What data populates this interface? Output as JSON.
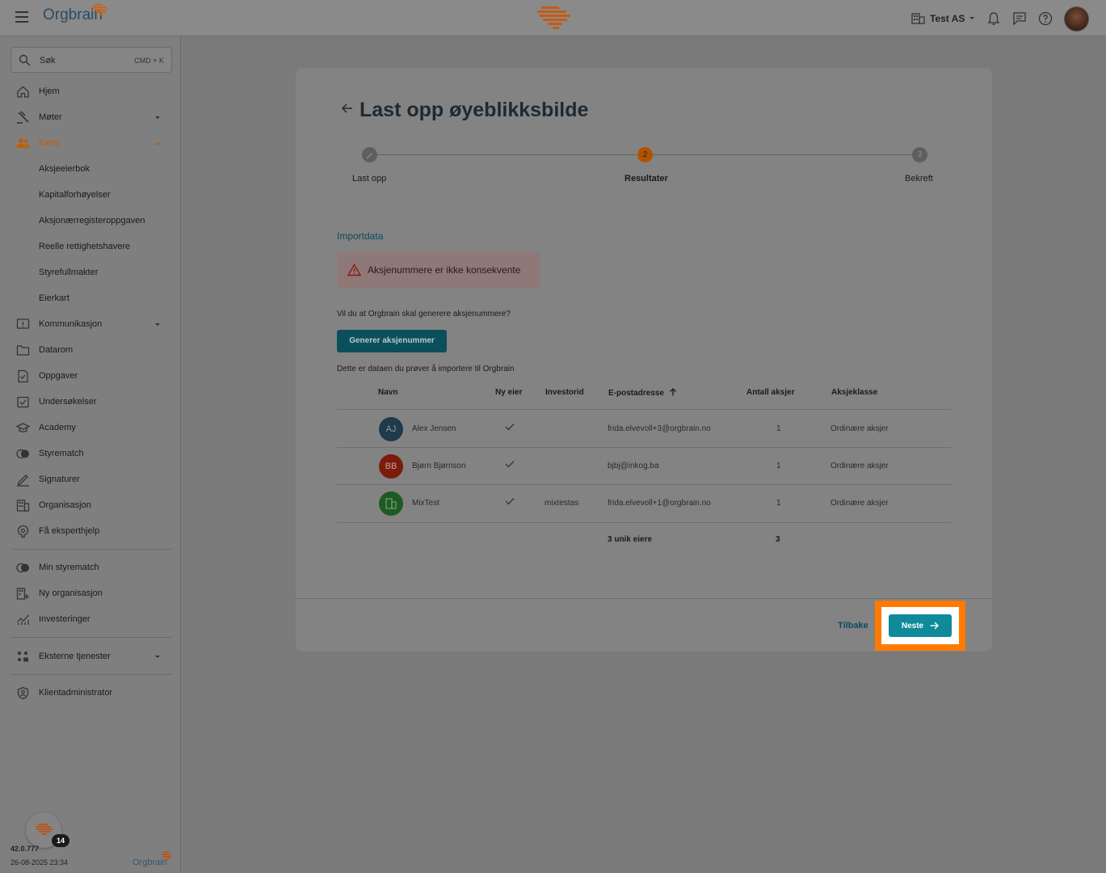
{
  "header": {
    "logo_text": "Orgbrain",
    "org_name": "Test AS"
  },
  "sidebar": {
    "search_placeholder": "Søk",
    "search_shortcut": "CMD + K",
    "items": [
      {
        "label": "Hjem"
      },
      {
        "label": "Møter"
      },
      {
        "label": "Eiere"
      },
      {
        "label": "Kommunikasjon"
      },
      {
        "label": "Datarom"
      },
      {
        "label": "Oppgaver"
      },
      {
        "label": "Undersøkelser"
      },
      {
        "label": "Academy"
      },
      {
        "label": "Styrematch"
      },
      {
        "label": "Signaturer"
      },
      {
        "label": "Organisasjon"
      },
      {
        "label": "Få eksperthjelp"
      }
    ],
    "eiere_sub": [
      "Aksjeeierbok",
      "Kapitalforhøyelser",
      "Aksjonærregisteroppgaven",
      "Reelle rettighetshavere",
      "Styrefullmakter",
      "Eierkart"
    ],
    "secondary": [
      {
        "label": "Min styrematch"
      },
      {
        "label": "Ny organisasjon"
      },
      {
        "label": "Investeringer"
      }
    ],
    "external": {
      "label": "Eksterne tjenester"
    },
    "admin": {
      "label": "Klientadministrator"
    },
    "badge_count": "14",
    "version": "42.0.777",
    "build_date": "26-08-2025 23:34",
    "footer_logo": "Orgbrain"
  },
  "main": {
    "title": "Last opp øyeblikksbilde",
    "steps": [
      {
        "num": "",
        "label": "Last opp"
      },
      {
        "num": "2",
        "label": "Resultater"
      },
      {
        "num": "3",
        "label": "Bekreft"
      }
    ],
    "section_title": "Importdata",
    "warning": "Aksjenummere er ikke konsekvente",
    "question": "Vil du at Orgbrain skal generere aksjenummere?",
    "generate_button": "Generer aksjenummer",
    "table_intro": "Dette er dataen du prøver å importere til Orgbrain",
    "columns": [
      "Navn",
      "Ny eier",
      "Investorid",
      "E-postadresse",
      "Antall aksjer",
      "Aksjeklasse"
    ],
    "rows": [
      {
        "initials": "AJ",
        "avatar_color": "#1f3a4a",
        "name": "Alex Jensen",
        "investorid": "",
        "email": "frida.elvevoll+3@orgbrain.no",
        "shares": "1",
        "class": "Ordinære aksjer"
      },
      {
        "initials": "BB",
        "avatar_color": "#7a1c0c",
        "name": "Bjørn Bjørnson",
        "investorid": "",
        "email": "bjbj@inkog.ba",
        "shares": "1",
        "class": "Ordinære aksjer"
      },
      {
        "initials": "",
        "avatar_color": "#1f5a22",
        "name": "MixTest",
        "investorid": "mixtestas",
        "email": "frida.elvevoll+1@orgbrain.no",
        "shares": "1",
        "class": "Ordinære aksjer"
      }
    ],
    "summary_owners": "3 unik eiere",
    "summary_shares": "3",
    "back_button": "Tilbake",
    "next_button": "Neste"
  }
}
